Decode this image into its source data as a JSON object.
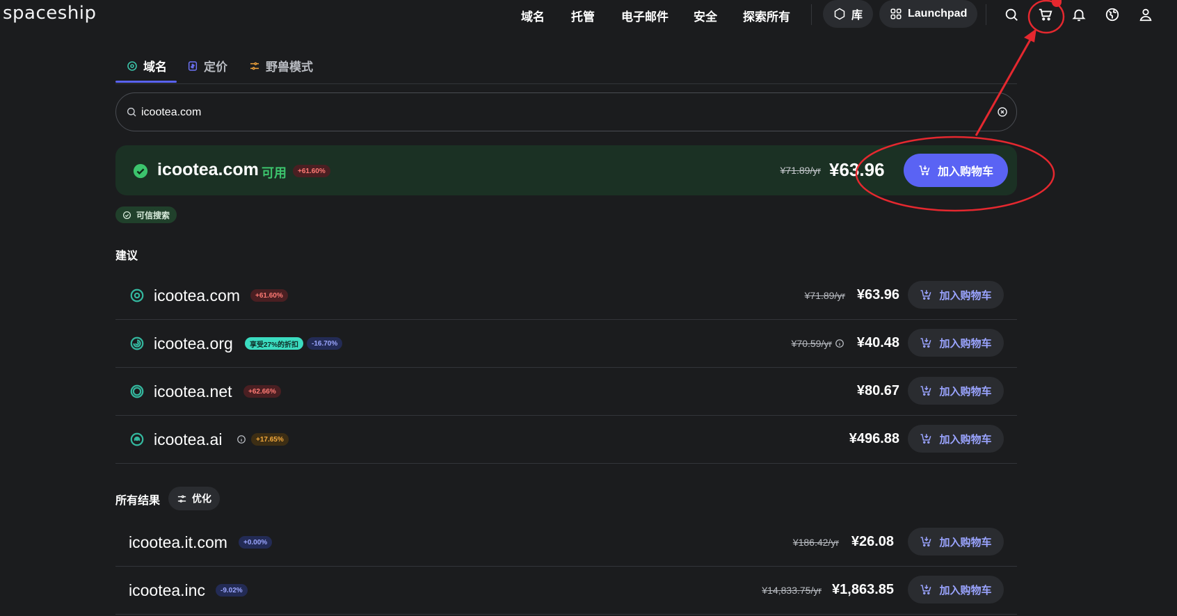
{
  "header": {
    "logo": "spaceship",
    "nav": [
      "域名",
      "托管",
      "电子邮件",
      "安全",
      "探索所有"
    ],
    "library_label": "库",
    "launchpad_label": "Launchpad",
    "icons": [
      "search-icon",
      "cart-icon",
      "bell-icon",
      "globe-icon",
      "user-icon"
    ]
  },
  "tabs": [
    {
      "label": "域名",
      "icon": "target-icon",
      "active": true
    },
    {
      "label": "定价",
      "icon": "price-tag-icon",
      "active": false
    },
    {
      "label": "野兽模式",
      "icon": "sliders-icon",
      "active": false
    }
  ],
  "search": {
    "value": "icootea.com",
    "placeholder": ""
  },
  "hero": {
    "domain": "icootea.com",
    "status": "可用",
    "tag": "+61.60%",
    "old_price": "¥71.89/yr",
    "price": "¥63.96",
    "cart_label": "加入购物车"
  },
  "trusted_label": "可信搜索",
  "suggestions_title": "建议",
  "suggestions": [
    {
      "domain": "icootea.com",
      "tags": [
        {
          "text": "+61.60%",
          "kind": "red"
        }
      ],
      "old_price": "¥71.89/yr",
      "info": false,
      "price": "¥63.96",
      "cart_label": "加入购物车"
    },
    {
      "domain": "icootea.org",
      "tags": [
        {
          "text": "享受27%的折扣",
          "kind": "teal"
        },
        {
          "text": "-16.70%",
          "kind": "blue"
        }
      ],
      "old_price": "¥70.59/yr",
      "info": true,
      "price": "¥40.48",
      "cart_label": "加入购物车"
    },
    {
      "domain": "icootea.net",
      "tags": [
        {
          "text": "+62.66%",
          "kind": "red"
        }
      ],
      "old_price": "",
      "info": false,
      "price": "¥80.67",
      "cart_label": "加入购物车"
    },
    {
      "domain": "icootea.ai",
      "tags": [
        {
          "text": "+17.65%",
          "kind": "orange"
        }
      ],
      "old_price": "",
      "info": false,
      "price": "¥496.88",
      "cart_label": "加入购物车"
    }
  ],
  "all_results_title": "所有结果",
  "refine_label": "优化",
  "all_results": [
    {
      "domain": "icootea.it.com",
      "tags": [
        {
          "text": "+0.00%",
          "kind": "blue"
        }
      ],
      "old_price": "¥186.42/yr",
      "price": "¥26.08",
      "cart_label": "加入购物车"
    },
    {
      "domain": "icootea.inc",
      "tags": [
        {
          "text": "-9.02%",
          "kind": "blue"
        }
      ],
      "old_price": "¥14,833.75/yr",
      "price": "¥1,863.85",
      "cart_label": "加入购物车"
    }
  ],
  "colors": {
    "background": "#1b1c1e",
    "accent": "#5a63f4",
    "available_green": "#3cc46d",
    "hero_bg": "#1b3124",
    "annotation_red": "#e5282f"
  }
}
